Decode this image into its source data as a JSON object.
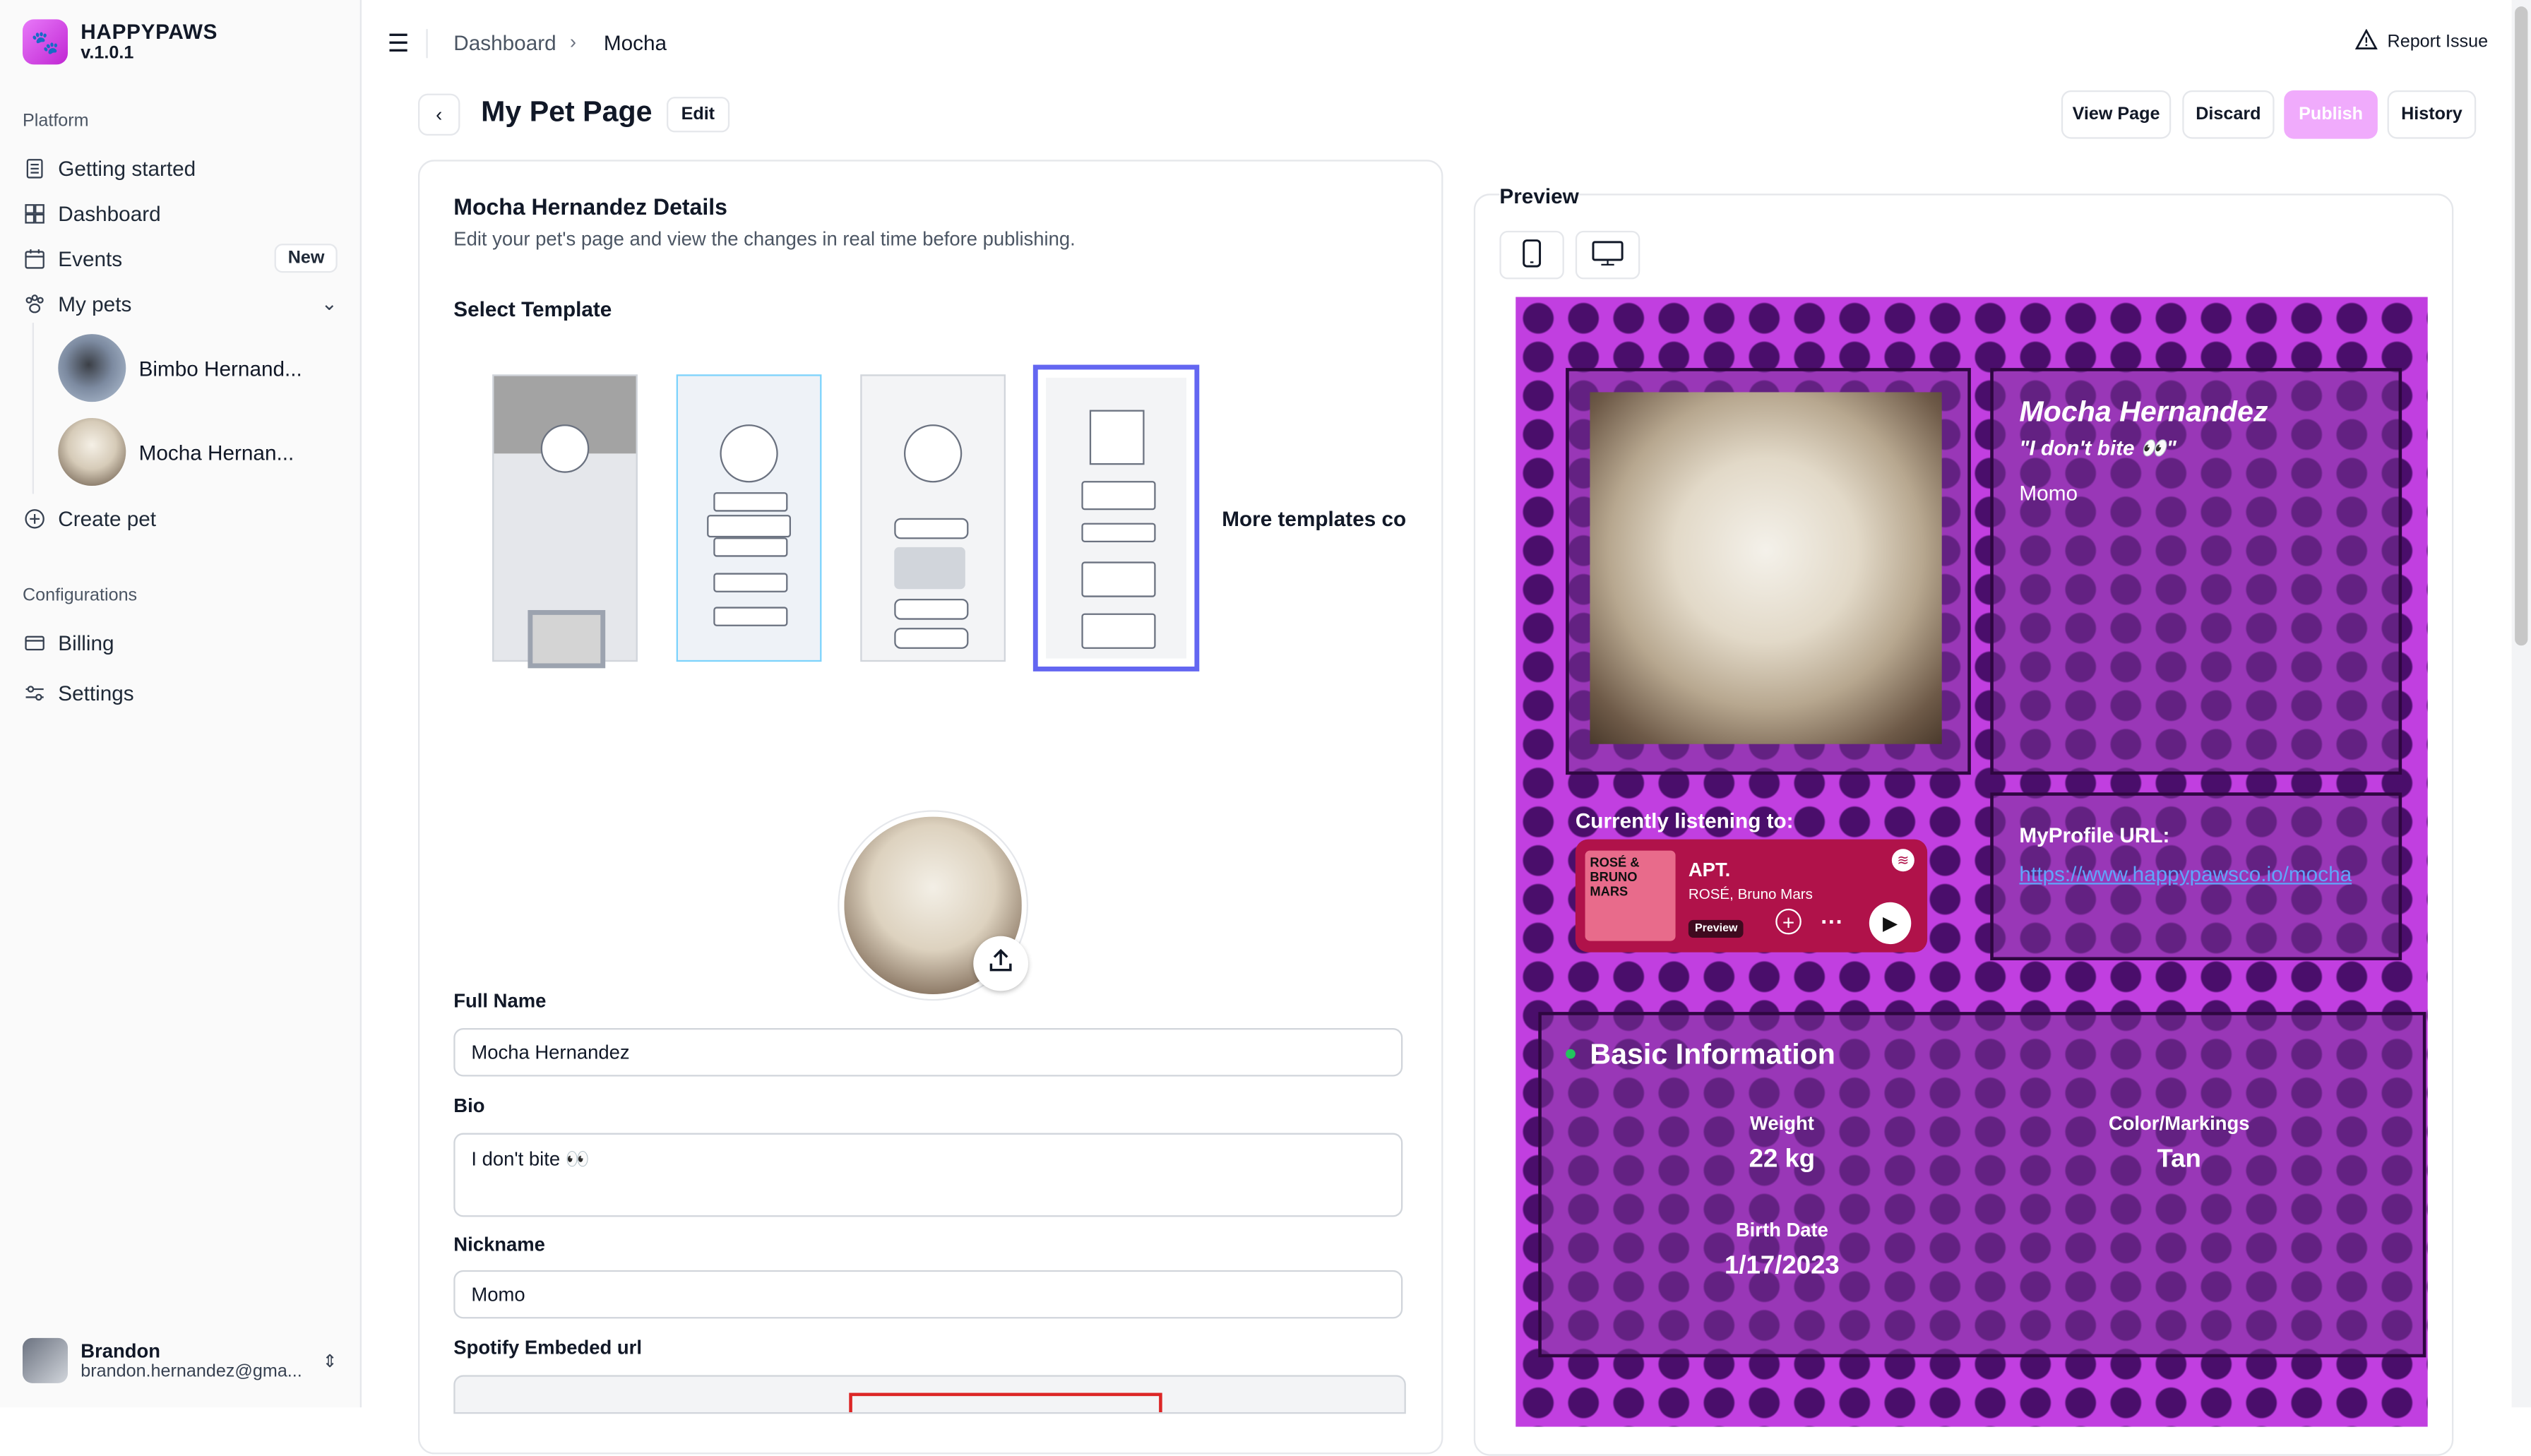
{
  "brand": {
    "name": "HAPPYPAWS",
    "version": "v.1.0.1"
  },
  "sidebar": {
    "platform_label": "Platform",
    "items": [
      {
        "label": "Getting started"
      },
      {
        "label": "Dashboard"
      },
      {
        "label": "Events",
        "badge": "New"
      },
      {
        "label": "My pets"
      }
    ],
    "pets": [
      {
        "label": "Bimbo Hernand..."
      },
      {
        "label": "Mocha Hernan..."
      }
    ],
    "create_pet": "Create pet",
    "config_label": "Configurations",
    "config_items": [
      {
        "label": "Billing"
      },
      {
        "label": "Settings"
      }
    ],
    "user": {
      "name": "Brandon",
      "email": "brandon.hernandez@gma..."
    }
  },
  "header": {
    "breadcrumb": [
      "Dashboard",
      "Mocha"
    ],
    "report_issue": "Report Issue"
  },
  "page": {
    "title": "My Pet Page",
    "edit_label": "Edit",
    "actions": {
      "view": "View Page",
      "discard": "Discard",
      "publish": "Publish",
      "history": "History"
    }
  },
  "details": {
    "title": "Mocha Hernandez Details",
    "subtitle": "Edit your pet's page and view the changes in real time before publishing.",
    "select_template": "Select Template",
    "more_templates": "More templates cor",
    "full_name_label": "Full Name",
    "full_name_value": "Mocha Hernandez",
    "bio_label": "Bio",
    "bio_value": "I don't bite 👀",
    "nickname_label": "Nickname",
    "nickname_value": "Momo",
    "spotify_label": "Spotify Embeded url"
  },
  "preview": {
    "label": "Preview",
    "pet_name": "Mocha Hernandez",
    "bio": "\"I don't bite 👀\"",
    "nickname": "Momo",
    "listening": "Currently listening to:",
    "song": {
      "title": "APT.",
      "artist": "ROSÉ, Bruno Mars",
      "preview_label": "Preview",
      "art_text": "ROSÉ & BRUNO MARS"
    },
    "url_label": "MyProfile URL:",
    "url": "https://www.happypawsco.io/mocha",
    "basic_title": "Basic Information",
    "weight_label": "Weight",
    "weight": "22 kg",
    "color_label": "Color/Markings",
    "color": "Tan",
    "birth_label": "Birth Date",
    "birth": "1/17/2023"
  },
  "colors": {
    "accent": "#f0abfc",
    "selected": "#6366f1",
    "page_bg": "#c13fe0"
  }
}
